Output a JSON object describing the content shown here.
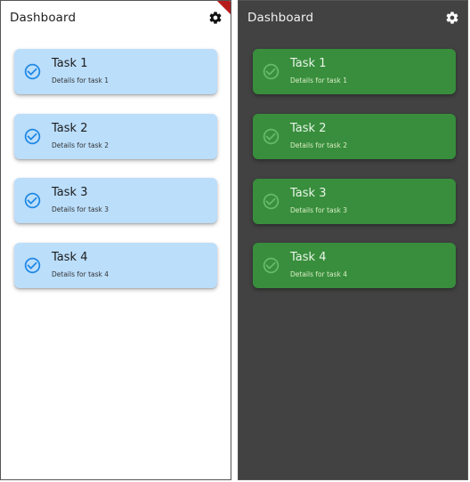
{
  "screens": [
    {
      "theme": "light",
      "title": "Dashboard",
      "settings_icon": "gear-icon",
      "debug_banner": "DEBUG",
      "colors": {
        "background": "#ffffff",
        "card": "#bbdefb",
        "check_icon": "#1e88e5",
        "text": "#1c1c1c"
      },
      "tasks": [
        {
          "title": "Task 1",
          "details": "Details for task 1",
          "icon": "check-circle-icon"
        },
        {
          "title": "Task 2",
          "details": "Details for task 2",
          "icon": "check-circle-icon"
        },
        {
          "title": "Task 3",
          "details": "Details for task 3",
          "icon": "check-circle-icon"
        },
        {
          "title": "Task 4",
          "details": "Details for task 4",
          "icon": "check-circle-icon"
        }
      ]
    },
    {
      "theme": "dark",
      "title": "Dashboard",
      "settings_icon": "gear-icon",
      "colors": {
        "background": "#424242",
        "card": "#388e3c",
        "check_icon": "#66bb6a",
        "text": "#e8f5e9"
      },
      "tasks": [
        {
          "title": "Task 1",
          "details": "Details for task 1",
          "icon": "check-circle-icon"
        },
        {
          "title": "Task 2",
          "details": "Details for task 2",
          "icon": "check-circle-icon"
        },
        {
          "title": "Task 3",
          "details": "Details for task 3",
          "icon": "check-circle-icon"
        },
        {
          "title": "Task 4",
          "details": "Details for task 4",
          "icon": "check-circle-icon"
        }
      ]
    }
  ]
}
